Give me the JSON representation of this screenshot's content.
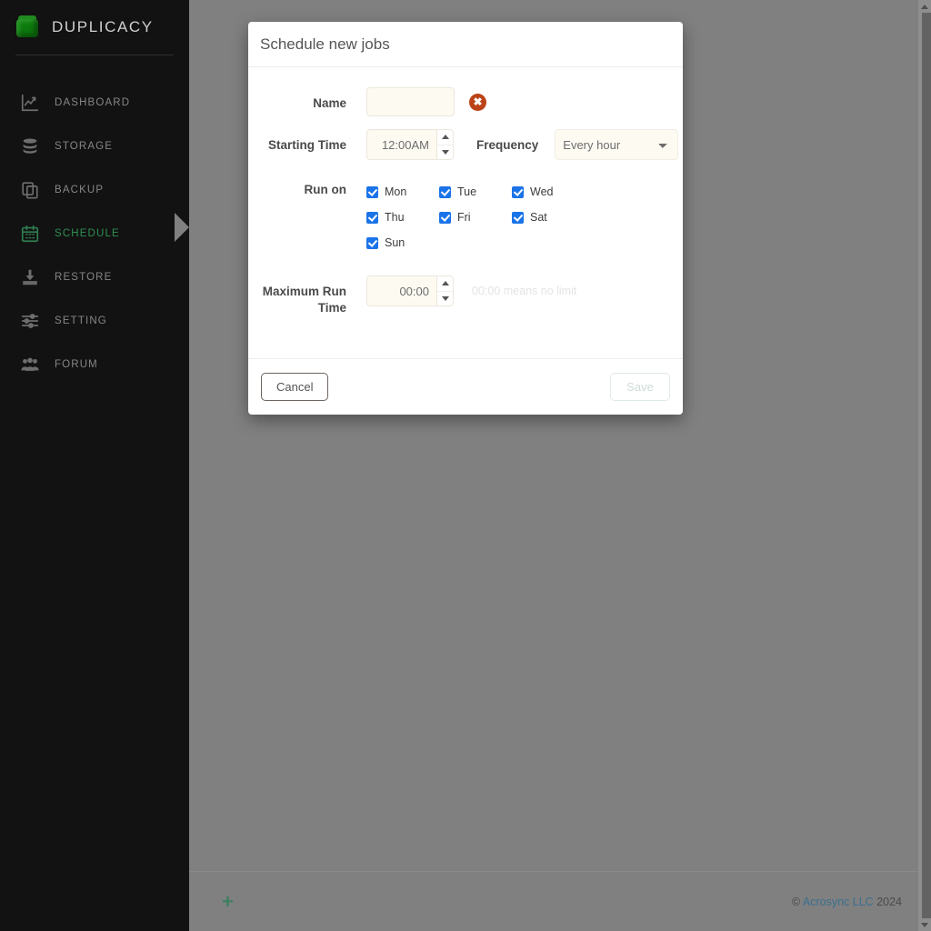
{
  "brand": {
    "name": "DUPLICACY",
    "logo_icon": "green-cube-logo",
    "logo_color": "#0d7a0d"
  },
  "sidebar": {
    "items": [
      {
        "label": "DASHBOARD",
        "icon": "chart-line-icon",
        "active": false
      },
      {
        "label": "STORAGE",
        "icon": "database-stack-icon",
        "active": false
      },
      {
        "label": "BACKUP",
        "icon": "copy-layers-icon",
        "active": false
      },
      {
        "label": "SCHEDULE",
        "icon": "calendar-icon",
        "active": true
      },
      {
        "label": "RESTORE",
        "icon": "download-tray-icon",
        "active": false
      },
      {
        "label": "SETTING",
        "icon": "sliders-icon",
        "active": false
      },
      {
        "label": "FORUM",
        "icon": "users-group-icon",
        "active": false
      }
    ],
    "active_color": "#2f8f52",
    "inactive_color": "#86868a"
  },
  "page_footer": {
    "add_button_label": "+",
    "add_button_icon": "plus-icon",
    "copyright_prefix": "© ",
    "copyright_link": "Acrosync LLC",
    "copyright_year": " 2024",
    "link_color": "#3c6e8f"
  },
  "scrollbar": {
    "up_arrow_icon": "chevron-up-icon",
    "down_arrow_icon": "chevron-down-icon"
  },
  "modal": {
    "title": "Schedule new jobs",
    "fields": {
      "name": {
        "label": "Name",
        "value": "",
        "placeholder": "",
        "error_icon": "error-circle-icon",
        "error_glyph": "✖",
        "error_color": "#bc4318"
      },
      "starting_time": {
        "label": "Starting Time",
        "value": "12:00AM",
        "spinner_up_icon": "spinner-up-icon",
        "spinner_down_icon": "spinner-down-icon"
      },
      "frequency": {
        "label": "Frequency",
        "selected": "Every hour",
        "options": [
          "Every hour"
        ],
        "chevron_icon": "chevron-down-icon"
      },
      "run_on": {
        "label": "Run on",
        "days": [
          {
            "label": "Mon",
            "checked": true
          },
          {
            "label": "Tue",
            "checked": true
          },
          {
            "label": "Wed",
            "checked": true
          },
          {
            "label": "Thu",
            "checked": true
          },
          {
            "label": "Fri",
            "checked": true
          },
          {
            "label": "Sat",
            "checked": true
          },
          {
            "label": "Sun",
            "checked": true
          }
        ],
        "checkbox_color": "#1a73e8"
      },
      "maximum_run_time": {
        "label": "Maximum Run Time",
        "value": "00:00",
        "hint": "00:00 means no limit",
        "spinner_up_icon": "spinner-up-icon",
        "spinner_down_icon": "spinner-down-icon"
      }
    },
    "buttons": {
      "cancel": "Cancel",
      "save": "Save",
      "save_disabled": true
    }
  }
}
